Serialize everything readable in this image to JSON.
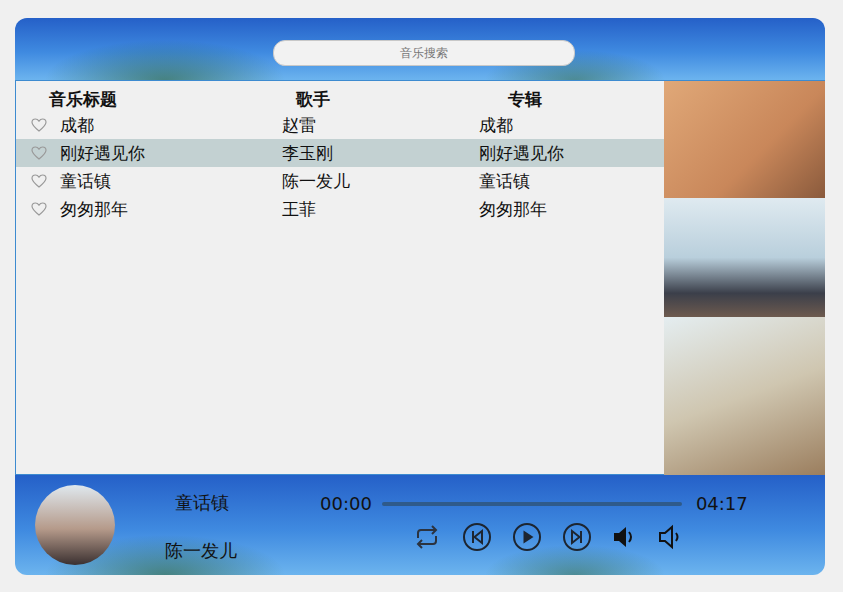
{
  "search": {
    "placeholder": "音乐搜索"
  },
  "table": {
    "columns": [
      "音乐标题",
      "歌手",
      "专辑"
    ],
    "rows": [
      {
        "title": "成都",
        "singer": "赵雷",
        "album": "成都",
        "liked": false,
        "selected": false
      },
      {
        "title": "刚好遇见你",
        "singer": "李玉刚",
        "album": "刚好遇见你",
        "liked": false,
        "selected": true
      },
      {
        "title": "童话镇",
        "singer": "陈一发儿",
        "album": "童话镇",
        "liked": false,
        "selected": false
      },
      {
        "title": "匆匆那年",
        "singer": "王菲",
        "album": "匆匆那年",
        "liked": false,
        "selected": false
      }
    ]
  },
  "player": {
    "title": "童话镇",
    "artist": "陈一发儿",
    "current": "00:00",
    "duration": "04:17",
    "level": 0,
    "playing": false
  }
}
